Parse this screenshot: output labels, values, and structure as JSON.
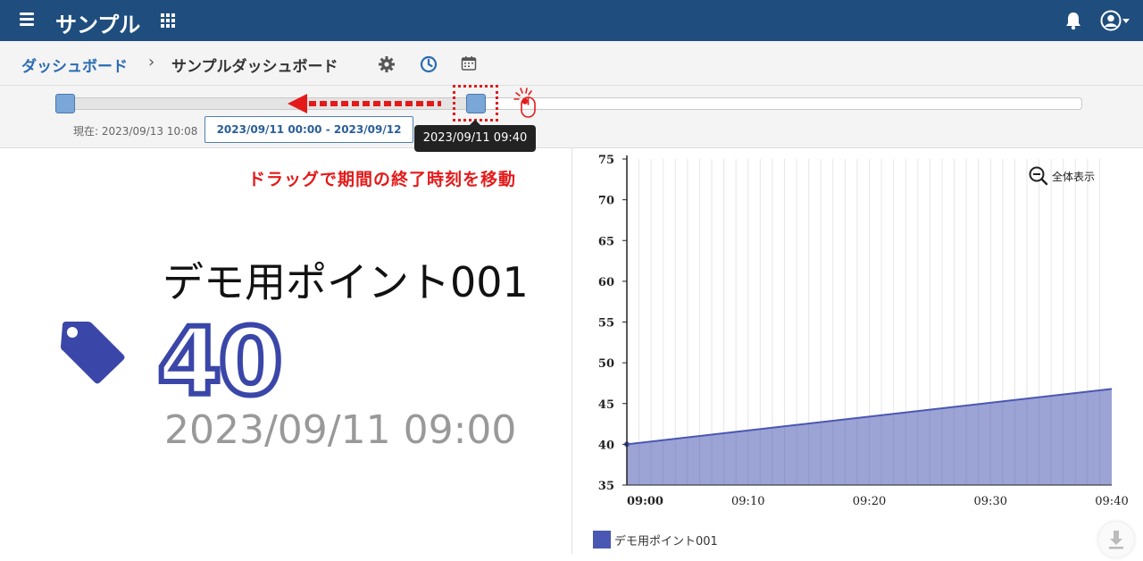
{
  "topbar": {
    "app_title": "サンプル",
    "icons": [
      "menu-icon",
      "apps-grid-icon",
      "bell-icon",
      "user-icon"
    ]
  },
  "breadcrumb": {
    "parent": "ダッシュボード",
    "separator": "›",
    "current": "サンプルダッシュボード",
    "icons": [
      "gear-icon",
      "clock-icon",
      "calendar-icon"
    ]
  },
  "time_slider": {
    "now_label": "現在: 2023/09/13 10:08",
    "range_label": "2023/09/11 00:00 - 2023/09/12 00:00",
    "tooltip": "2023/09/11 09:40"
  },
  "annotation": "ドラッグで期間の終了時刻を移動",
  "point_panel": {
    "name": "デモ用ポイント001",
    "value": "40",
    "timestamp": "2023/09/11 09:00",
    "icon": "tag-icon",
    "value_color": "#3a46a8"
  },
  "chart_panel": {
    "zoom_label": "全体表示",
    "legend_label": "デモ用ポイント001"
  },
  "chart_data": {
    "type": "area",
    "x": [
      "09:00",
      "09:40"
    ],
    "y": [
      40,
      46.8
    ],
    "xticks": [
      "09:00",
      "09:10",
      "09:20",
      "09:30",
      "09:40"
    ],
    "yticks": [
      35,
      40,
      45,
      50,
      55,
      60,
      65,
      70,
      75
    ],
    "ylim": [
      35,
      75
    ],
    "series": [
      {
        "name": "デモ用ポイント001",
        "color": "#4a57b3"
      }
    ],
    "grid": "vertical"
  },
  "colors": {
    "topbar": "#1f4e7e",
    "link": "#2a6bb3",
    "annotation": "#e41a1a",
    "series": "#4a57b3"
  }
}
